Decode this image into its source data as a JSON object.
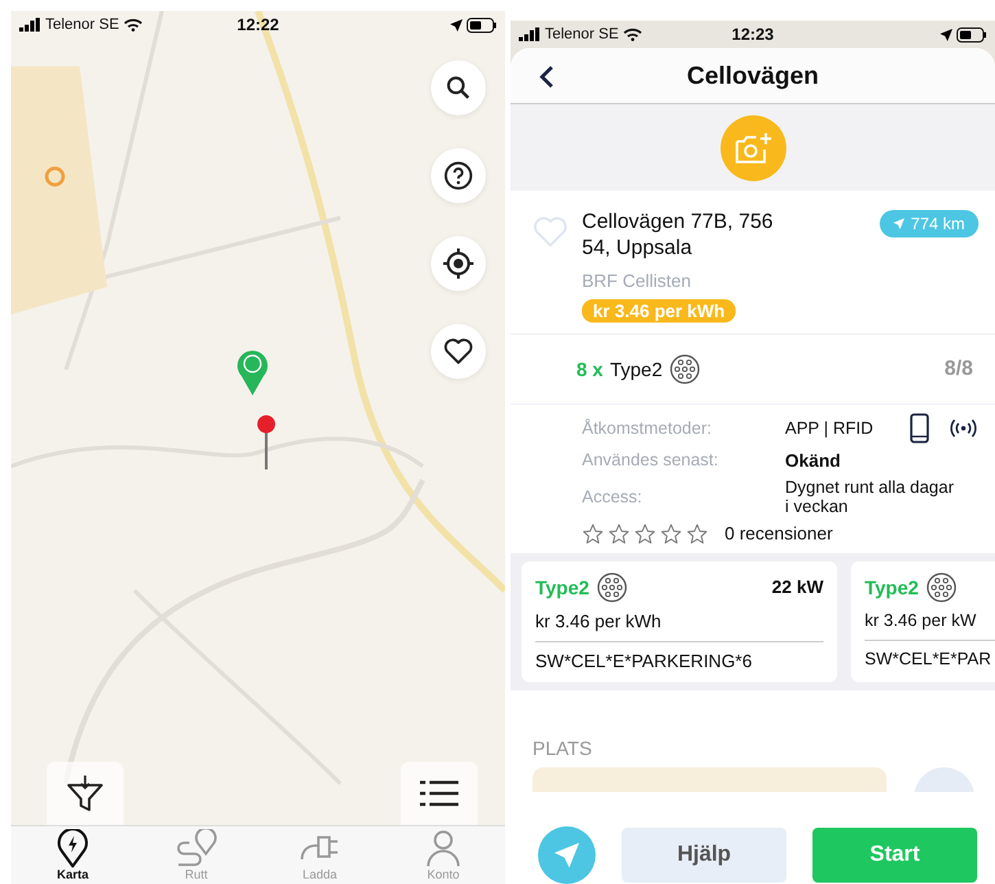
{
  "left_screen": {
    "status_bar": {
      "carrier": "Telenor SE",
      "time": "12:22"
    },
    "tab_bar": [
      {
        "label": "Karta",
        "selected": true
      },
      {
        "label": "Rutt",
        "selected": false
      },
      {
        "label": "Ladda",
        "selected": false
      },
      {
        "label": "Konto",
        "selected": false
      }
    ]
  },
  "right_screen": {
    "status_bar": {
      "carrier": "Telenor SE",
      "time": "12:23"
    },
    "header": {
      "title": "Cellovägen"
    },
    "station": {
      "address": "Cellovägen 77B, 756 54, Uppsala",
      "distance": "774 km",
      "operator": "BRF Cellisten",
      "price": "kr 3.46 per kWh"
    },
    "connector_summary": {
      "count": "8 x",
      "type": "Type2",
      "availability": "8/8"
    },
    "details": [
      {
        "label": "Åtkomstmetoder:",
        "value": "APP | RFID",
        "kind": "plain"
      },
      {
        "label": "Användes senast:",
        "value": "Okänd",
        "kind": "bold"
      },
      {
        "label": "Access:",
        "value": "Dygnet runt alla dagar i veckan",
        "kind": "plain"
      }
    ],
    "rating": {
      "stars": 0,
      "reviews": "0 recensioner"
    },
    "connectors": [
      {
        "type": "Type2",
        "power": "22 kW",
        "price": "kr 3.46 per kWh",
        "evse_id": "SW*CEL*E*PARKERING*6"
      },
      {
        "type": "Type2",
        "price": "kr 3.46 per kW",
        "evse_id": "SW*CEL*E*PAR"
      }
    ],
    "location_heading": "PLATS",
    "buttons": [
      {
        "label": "Hjälp",
        "kind": "secondary"
      },
      {
        "label": "Start",
        "kind": "primary"
      }
    ]
  }
}
